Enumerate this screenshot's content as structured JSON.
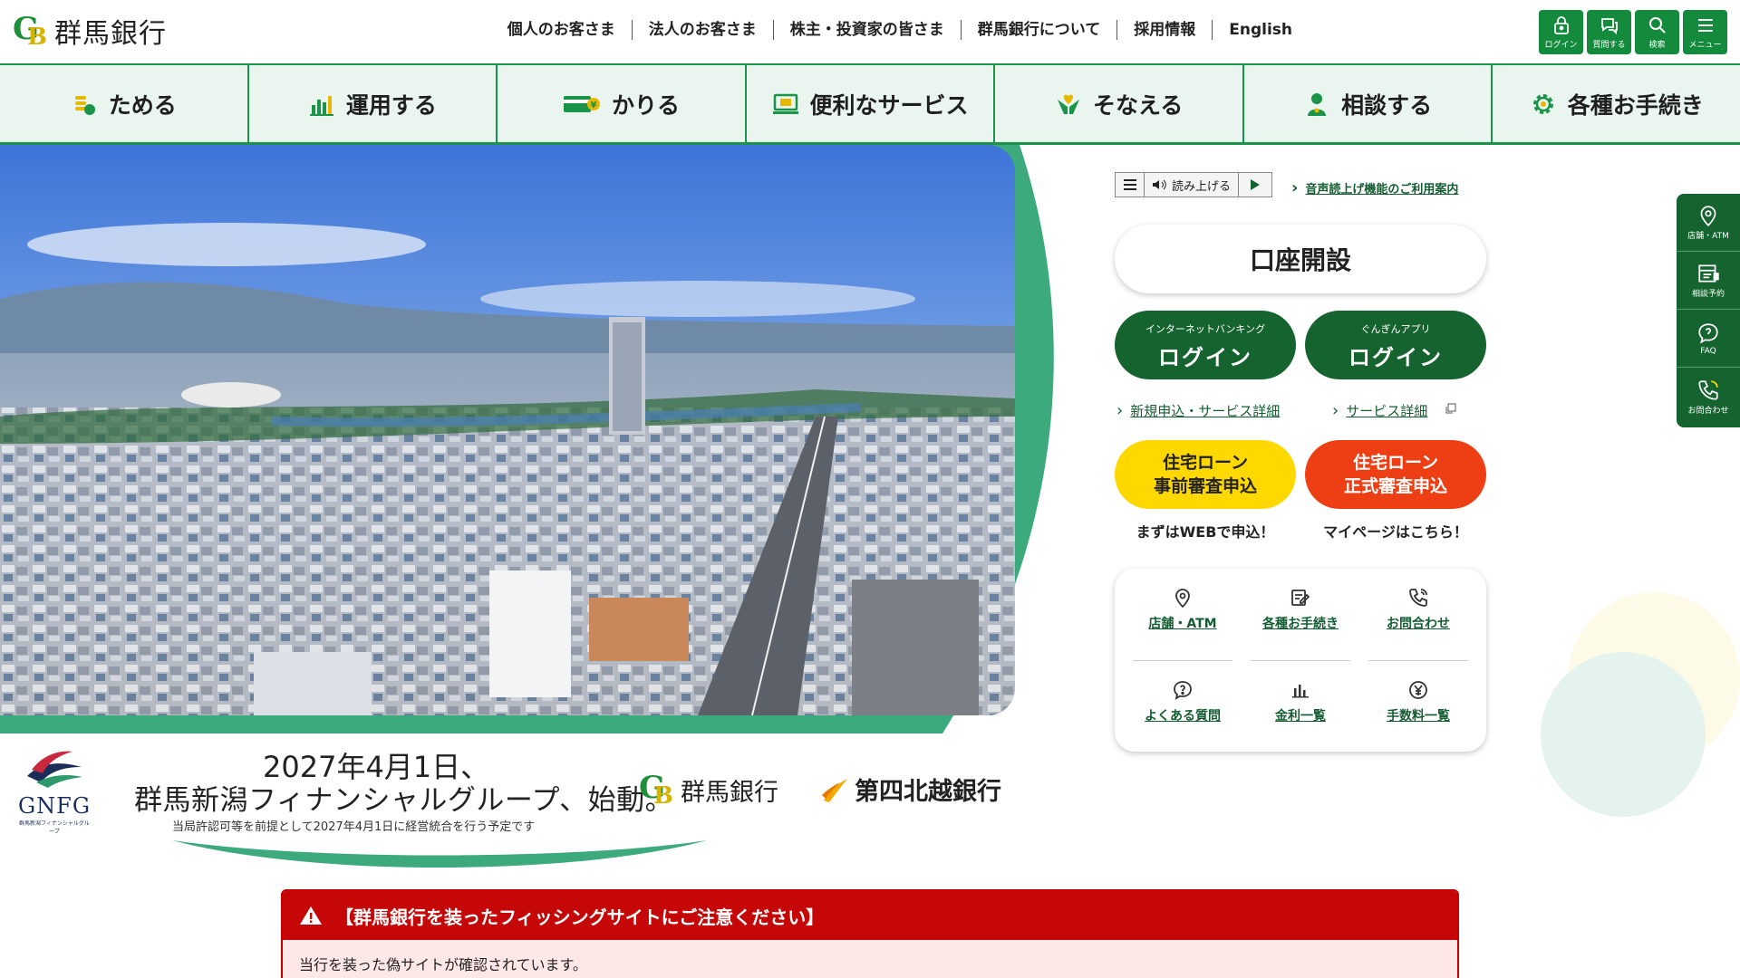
{
  "header": {
    "bank_name": "群馬銀行",
    "top_links": [
      "個人のお客さま",
      "法人のお客さま",
      "株主・投資家の皆さま",
      "群馬銀行について",
      "採用情報",
      "English"
    ],
    "quick_buttons": [
      {
        "label": "ログイン",
        "icon": "lock-icon"
      },
      {
        "label": "質問する",
        "icon": "chat-icon"
      },
      {
        "label": "検索",
        "icon": "search-icon"
      },
      {
        "label": "メニュー",
        "icon": "menu-icon"
      }
    ]
  },
  "gnav": {
    "items": [
      {
        "label": "ためる",
        "icon": "coins-icon"
      },
      {
        "label": "運用する",
        "icon": "bar-chart-icon"
      },
      {
        "label": "かりる",
        "icon": "card-icon"
      },
      {
        "label": "便利なサービス",
        "icon": "monitor-icon"
      },
      {
        "label": "そなえる",
        "icon": "hands-icon"
      },
      {
        "label": "相談する",
        "icon": "person-icon"
      },
      {
        "label": "各種お手続き",
        "icon": "gear-icon"
      }
    ]
  },
  "banner": {
    "date": "2027年4月1日、",
    "headline": "群馬新潟フィナンシャルグループ、始動。",
    "note": "当局許認可等を前提として2027年4月1日に経営統合を行う予定です",
    "gnfg_logo": "GNFG",
    "gnfg_sub": "群馬新潟フィナンシャルグループ",
    "bank1": "群馬銀行",
    "bank2": "第四北越銀行"
  },
  "reader": {
    "read_label": "読み上げる",
    "help_link": "音声読上げ機能のご利用案内"
  },
  "right_panel": {
    "account_open": "口座開設",
    "ib_login": {
      "small": "インターネットバンキング",
      "big": "ログイン",
      "link": "新規申込・サービス詳細"
    },
    "app_login": {
      "small": "ぐんぎんアプリ",
      "big": "ログイン",
      "link": "サービス詳細"
    },
    "loan_pre": {
      "line1": "住宅ローン",
      "line2": "事前審査申込",
      "note": "まずはWEBで申込！",
      "color": "#ffd800"
    },
    "loan_formal": {
      "line1": "住宅ローン",
      "line2": "正式審査申込",
      "note": "マイページはこちら！",
      "color": "#ee3f14"
    },
    "quick_links": [
      {
        "label": "店舗・ATM",
        "icon": "map-pin-icon"
      },
      {
        "label": "各種お手続き",
        "icon": "edit-icon"
      },
      {
        "label": "お問合わせ",
        "icon": "phone-icon"
      },
      {
        "label": "よくある質問",
        "icon": "question-icon"
      },
      {
        "label": "金利一覧",
        "icon": "bar-chart-icon"
      },
      {
        "label": "手数料一覧",
        "icon": "yen-icon"
      }
    ]
  },
  "side_menu": [
    {
      "label": "店舗・ATM",
      "icon": "map-pin-icon"
    },
    {
      "label": "相談予約",
      "icon": "calendar-icon"
    },
    {
      "label": "FAQ",
      "icon": "question-icon"
    },
    {
      "label": "お問合わせ",
      "icon": "phone-icon"
    }
  ],
  "alert": {
    "title": "【群馬銀行を装ったフィッシングサイトにご注意ください】",
    "body": "当行を装った偽サイトが確認されています。"
  },
  "colors": {
    "brand_green": "#15632f",
    "nav_green": "#1a9448",
    "alert_red": "#c50707"
  }
}
